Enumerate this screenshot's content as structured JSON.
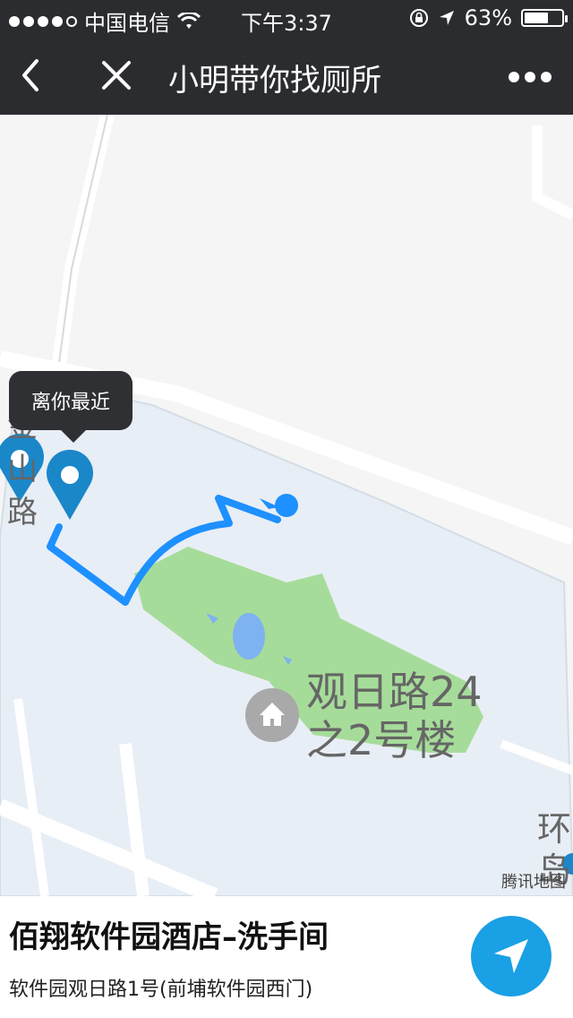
{
  "status_bar": {
    "carrier": "中国电信",
    "time": "下午3:37",
    "battery_percent": "63%",
    "signal_dots_filled": 4,
    "signal_dots_total": 5,
    "battery_level": 0.63
  },
  "nav_bar": {
    "title": "小明带你找厕所",
    "back_icon": "chevron-left-icon",
    "close_icon": "close-icon",
    "more_icon": "more-dots-icon"
  },
  "map": {
    "tooltip": "离你最近",
    "poi_label_line1": "观日路24",
    "poi_label_line2": "之2号楼",
    "road_label_left": "金山路",
    "road_label_right": "环岛",
    "watermark": "腾讯地图"
  },
  "place": {
    "name": "佰翔软件园酒店–洗手间",
    "address": "软件园观日路1号(前埔软件园西门)"
  },
  "colors": {
    "bar_bg": "#2b2c30",
    "route": "#1e90ff",
    "marker": "#1a87c9",
    "nav_button": "#1aa0e4",
    "park": "#a6dc9a",
    "block": "#e8eef5"
  }
}
